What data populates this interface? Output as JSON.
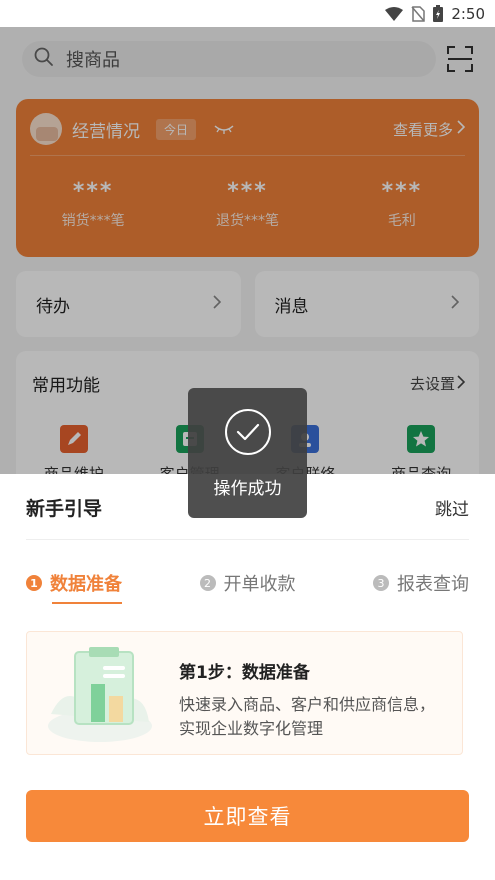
{
  "status_bar": {
    "time": "2:50",
    "icons": [
      "wifi-icon",
      "no-sim-icon",
      "battery-icon"
    ]
  },
  "search": {
    "placeholder": "搜商品",
    "scan_icon": "scan-icon"
  },
  "business_card": {
    "title": "经营情况",
    "period": "今日",
    "more": "查看更多",
    "stats": [
      {
        "value": "***",
        "label": "销货***笔"
      },
      {
        "value": "***",
        "label": "退货***笔"
      },
      {
        "value": "***",
        "label": "毛利"
      }
    ],
    "accent": "#f0823a"
  },
  "panels": [
    {
      "label": "待办"
    },
    {
      "label": "消息"
    }
  ],
  "functions": {
    "title": "常用功能",
    "settings": "去设置",
    "items": [
      {
        "label": "商品维护",
        "icon": "edit-icon",
        "color": "#e8612f"
      },
      {
        "label": "客户管理",
        "icon": "customer-icon",
        "color": "#1aa15a"
      },
      {
        "label": "客户联络",
        "icon": "contact-icon",
        "color": "#3b6fd8"
      },
      {
        "label": "商品查询",
        "icon": "star-icon",
        "color": "#1aa15a"
      }
    ]
  },
  "toast": {
    "text": "操作成功",
    "icon": "check-circle-icon"
  },
  "guide": {
    "title": "新手引导",
    "skip": "跳过",
    "steps": [
      {
        "num": "1",
        "label": "数据准备",
        "active": true
      },
      {
        "num": "2",
        "label": "开单收款",
        "active": false
      },
      {
        "num": "3",
        "label": "报表查询",
        "active": false
      }
    ],
    "card": {
      "title": "第1步：数据准备",
      "description": "快速录入商品、客户和供应商信息，实现企业数字化管理"
    },
    "cta": "立即查看",
    "accent": "#f7893a"
  }
}
